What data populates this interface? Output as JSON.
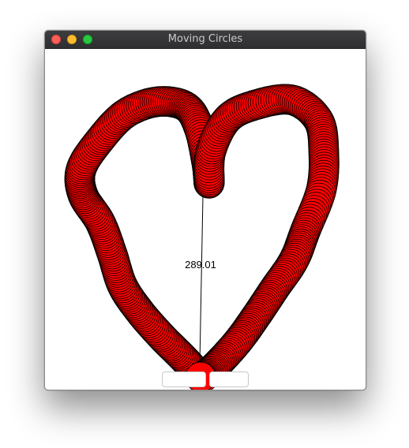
{
  "window": {
    "title": "Moving Circles"
  },
  "scene": {
    "distance_label": "289.01",
    "circle_fill": "#ff0000",
    "circle_stroke": "#000000",
    "background": "#ffffff"
  },
  "controls": {
    "left_button_label": "",
    "right_button_label": ""
  }
}
